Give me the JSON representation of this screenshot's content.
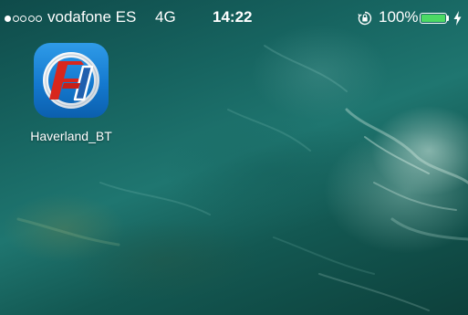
{
  "status_bar": {
    "signal_bars_filled": 1,
    "signal_bars_total": 5,
    "carrier": "vodafone ES",
    "network": "4G",
    "time": "14:22",
    "orientation_lock_icon": "orientation-lock-icon",
    "battery_percent": "100%",
    "battery_level": 1.0,
    "battery_color": "#4cd964",
    "charging_icon": "lightning-bolt-icon"
  },
  "home_screen": {
    "apps": [
      {
        "label": "Haverland_BT",
        "icon": "haverland-app-icon"
      }
    ]
  },
  "colors": {
    "wallpaper": "#176561",
    "app_icon_blue": "#1479cf",
    "app_icon_red": "#d8261c"
  }
}
